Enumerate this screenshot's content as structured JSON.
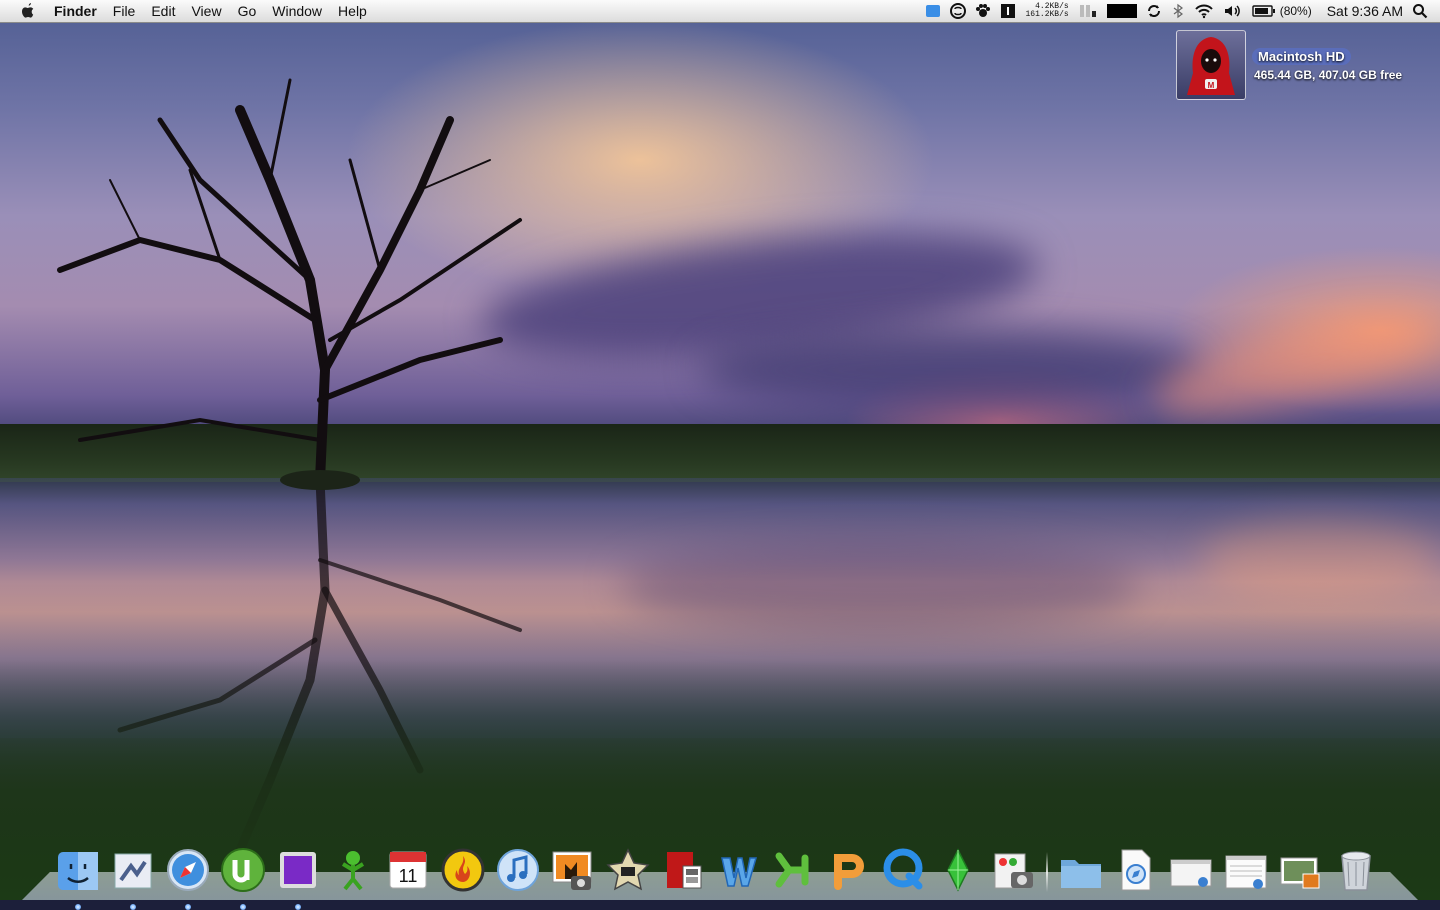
{
  "menubar": {
    "app_name": "Finder",
    "menus": [
      "File",
      "Edit",
      "View",
      "Go",
      "Window",
      "Help"
    ],
    "net_up": "4.2KB/s",
    "net_down": "161.2KB/s",
    "battery_pct": "(80%)",
    "clock": "Sat 9:36 AM"
  },
  "drive": {
    "name": "Macintosh HD",
    "info": "465.44 GB, 407.04 GB free"
  },
  "dock": {
    "apps": [
      {
        "name": "finder-icon",
        "running": true
      },
      {
        "name": "mail-icon",
        "running": true
      },
      {
        "name": "safari-icon",
        "running": true
      },
      {
        "name": "utorrent-icon",
        "running": true
      },
      {
        "name": "square-app-icon",
        "running": true
      },
      {
        "name": "adium-icon",
        "running": false
      },
      {
        "name": "ical-icon",
        "running": false
      },
      {
        "name": "burn-icon",
        "running": false
      },
      {
        "name": "itunes-icon",
        "running": false
      },
      {
        "name": "iphoto-icon",
        "running": false
      },
      {
        "name": "imovie-icon",
        "running": false
      },
      {
        "name": "photo-booth-icon",
        "running": false
      },
      {
        "name": "word-icon",
        "running": false
      },
      {
        "name": "excel-icon",
        "running": false
      },
      {
        "name": "powerpoint-icon",
        "running": false
      },
      {
        "name": "quicktime-icon",
        "running": false
      },
      {
        "name": "sims-icon",
        "running": false
      },
      {
        "name": "image-capture-icon",
        "running": false
      }
    ],
    "stacks": [
      "folder-icon",
      "document-icon",
      "window-stack-icon",
      "window-stack-2-icon",
      "picture-stack-icon",
      "trash-icon"
    ]
  }
}
